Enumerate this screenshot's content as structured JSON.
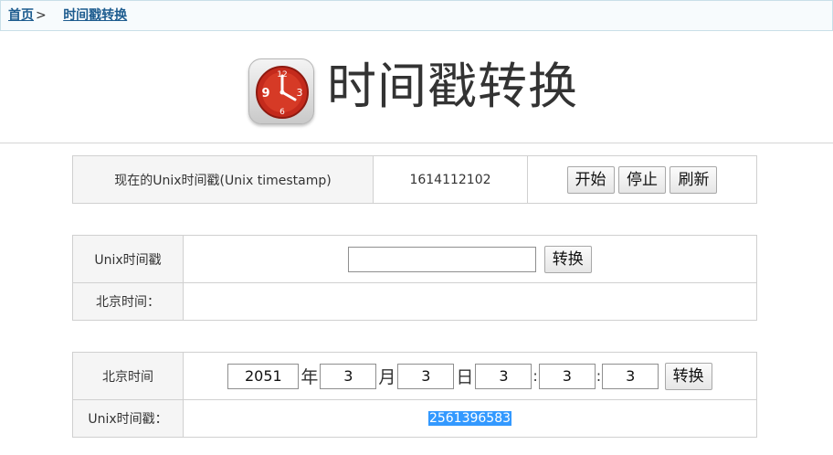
{
  "breadcrumb": {
    "home": "首页",
    "separator": ">",
    "current": "时间戳转换"
  },
  "header": {
    "title": "时间戳转换",
    "logo_icon": "clock-icon"
  },
  "now_section": {
    "label": "现在的Unix时间戳(Unix timestamp)",
    "timestamp": "1614112102",
    "buttons": {
      "start": "开始",
      "stop": "停止",
      "refresh": "刷新"
    }
  },
  "unix_to_beijing": {
    "input_label": "Unix时间戳",
    "input_value": "",
    "convert_label": "转换",
    "result_label": "北京时间：",
    "result_value": ""
  },
  "beijing_to_unix": {
    "input_label": "北京时间",
    "year": "2051",
    "year_unit": "年",
    "month": "3",
    "month_unit": "月",
    "day": "3",
    "day_unit": "日",
    "hour": "3",
    "minute": "3",
    "second": "3",
    "time_sep": ":",
    "convert_label": "转换",
    "result_label": "Unix时间戳：",
    "result_value": "2561396583"
  },
  "colors": {
    "link": "#1d5c8f",
    "selection": "#3399ff",
    "label_bg": "#f5f5f5",
    "border": "#d0d0d0"
  }
}
